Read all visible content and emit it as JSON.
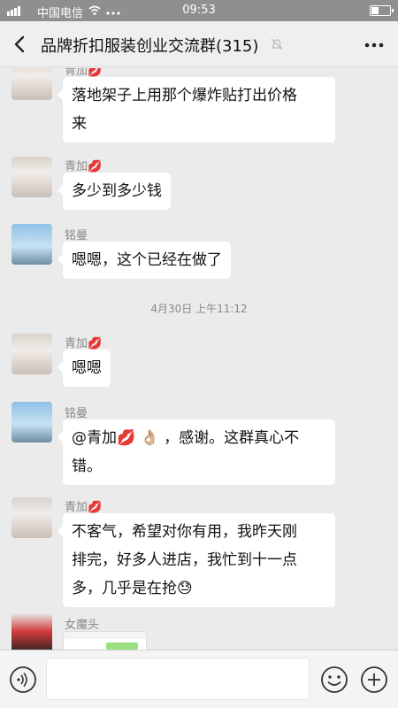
{
  "status_bar": {
    "carrier": "中国电信",
    "time": "09:53"
  },
  "header": {
    "title": "品牌折扣服装创业交流群(315)"
  },
  "messages": [
    {
      "sender": "青加💋",
      "text_lines": [
        "落地架子上用那个爆炸贴打出价格",
        "来"
      ]
    },
    {
      "sender": "青加💋",
      "text_lines": [
        "多少到多少钱"
      ]
    },
    {
      "sender": "铭曼",
      "text_lines": [
        "嗯嗯，这个已经在做了"
      ]
    },
    {
      "sender": "青加💋",
      "text_lines": [
        "嗯嗯"
      ]
    },
    {
      "sender": "铭曼",
      "text_lines": [
        "@青加💋 👌🏼 ，感谢。这群真心不",
        "错。"
      ]
    },
    {
      "sender": "青加💋",
      "text_lines": [
        "不客气，希望对你有用，我昨天刚",
        "排完，好多人进店，我忙到十一点",
        "多，几乎是在抢😓"
      ]
    },
    {
      "sender": "女魔头",
      "text_lines": []
    }
  ],
  "timestamp": "4月30日 上午11:12",
  "icons": {
    "back": "chevron-left-icon",
    "mute": "bell-muted-icon",
    "more": "more-dots-icon",
    "voice": "voice-icon",
    "emoji": "emoji-icon",
    "plus": "plus-icon"
  }
}
